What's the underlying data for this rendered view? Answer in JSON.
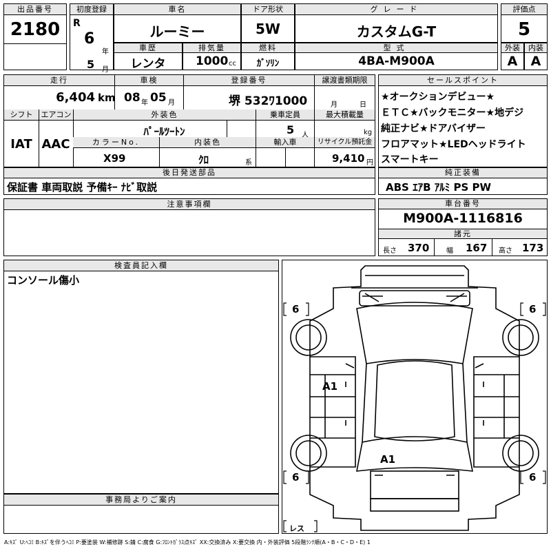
{
  "header": {
    "lot_label": "出品番号",
    "lot_number": "2180",
    "first_reg_label": "初度登録",
    "era": "R",
    "year": "6",
    "year_unit": "年",
    "month": "5",
    "month_unit": "月",
    "car_name_label": "車名",
    "car_name": "ルーミー",
    "door_label": "ドア形状",
    "door": "5W",
    "grade_label": "グレード",
    "grade": "カスタムG-T",
    "score_label": "評価点",
    "score": "5",
    "history_label": "車歴",
    "history": "レンタ",
    "displacement_label": "排気量",
    "displacement": "1000",
    "displacement_unit": "cc",
    "fuel_label": "燃料",
    "fuel": "ｶﾞｿﾘﾝ",
    "model_label": "型式",
    "model": "4BA-M900A",
    "exterior_label": "外装",
    "exterior": "A",
    "interior_label": "内装",
    "interior": "A"
  },
  "specs": {
    "mileage_label": "走行",
    "mileage": "6,404",
    "mileage_unit": "km",
    "inspection_label": "車検",
    "inspection_year": "08",
    "inspection_year_unit": "年",
    "inspection_month": "05",
    "inspection_month_unit": "月",
    "reg_label": "登録番号",
    "reg_number": "堺 532ﾜ1000",
    "transfer_label": "譲渡書類期限",
    "transfer_month_unit": "月",
    "transfer_day_unit": "日",
    "shift_label": "シフト",
    "shift": "IAT",
    "ac_label": "エアコン",
    "ac": "AAC",
    "ext_color_label": "外装色",
    "ext_color": "ﾊﾟｰﾙﾂｰﾄﾝ",
    "capacity_label": "乗車定員",
    "capacity": "5",
    "capacity_unit": "人",
    "load_label": "最大積載量",
    "load_unit": "kg",
    "color_no_label": "カラーNo.",
    "color_no": "X99",
    "int_color_label": "内装色",
    "int_color": "ｸﾛ",
    "int_color_unit": "系",
    "import_label": "輸入車",
    "recycle_label": "リサイクル預託金",
    "recycle": "9,410",
    "recycle_unit": "円"
  },
  "selling_points": {
    "label": "セールスポイント",
    "lines": [
      "★オークションデビュー★",
      "ＥＴＣ★バックモニター★地デジ",
      "純正ナビ★ドアバイザー",
      "フロアマット★LEDヘッドライト",
      "スマートキー"
    ]
  },
  "later_parts": {
    "label": "後日発送部品",
    "text": "保証書 車両取説 予備ｷｰ ﾅﾋﾞ取説"
  },
  "oem_equipment": {
    "label": "純正装備",
    "text": "ABS ｴｱB ｱﾙﾐ PS PW"
  },
  "notes": {
    "label": "注意事項欄",
    "text": ""
  },
  "chassis": {
    "label": "車台番号",
    "number": "M900A-1116816",
    "dims_label": "諸元",
    "length_label": "長さ",
    "length": "370",
    "width_label": "幅",
    "width": "167",
    "height_label": "高さ",
    "height": "173"
  },
  "inspector": {
    "label": "検査員記入欄",
    "text": "コンソール傷小"
  },
  "office": {
    "label": "事務局よりご案内",
    "text": ""
  },
  "diagram": {
    "tire_front_left": "6",
    "tire_front_right": "6",
    "tire_rear_left": "6",
    "tire_rear_right": "6",
    "mark_side": "A1",
    "mark_rear": "A1",
    "spare": "レス"
  },
  "legend": "A:ｷｽﾞ U:ﾍｺﾐ B:ｷｽﾞを伴うﾍｺﾐ P:要塗装 W:補修跡 S:錆 C:腐食 G:ﾌﾛﾝﾄｶﾞﾗｽ点ｷｽﾞ XX:交換済み X:要交換 内・外装評価 5段階ﾗﾝｸ順(A・B・C・D・E) 1"
}
